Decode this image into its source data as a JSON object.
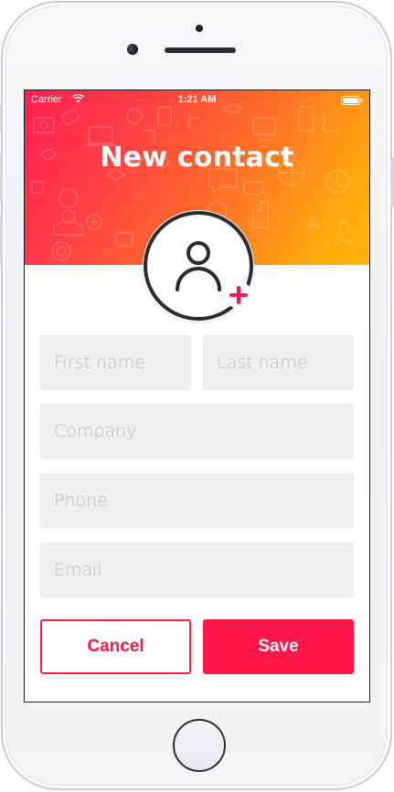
{
  "status_bar": {
    "carrier": "Carrier",
    "time": "1:21 AM",
    "wifi_icon": "wifi-icon",
    "battery_icon": "battery-icon"
  },
  "header": {
    "title": "New contact",
    "gradient_colors": [
      "#ff1f52",
      "#ff6a2a",
      "#ffb40a"
    ]
  },
  "avatar": {
    "icon": "person-icon",
    "add_icon": "plus-icon",
    "add_color": "#ff1648"
  },
  "form": {
    "first_name": {
      "value": "",
      "placeholder": "First name"
    },
    "last_name": {
      "value": "",
      "placeholder": "Last name"
    },
    "company": {
      "value": "",
      "placeholder": "Company"
    },
    "phone": {
      "value": "",
      "placeholder": "Phone"
    },
    "email": {
      "value": "",
      "placeholder": "Email"
    }
  },
  "actions": {
    "cancel_label": "Cancel",
    "save_label": "Save",
    "accent_color": "#ff1648"
  }
}
